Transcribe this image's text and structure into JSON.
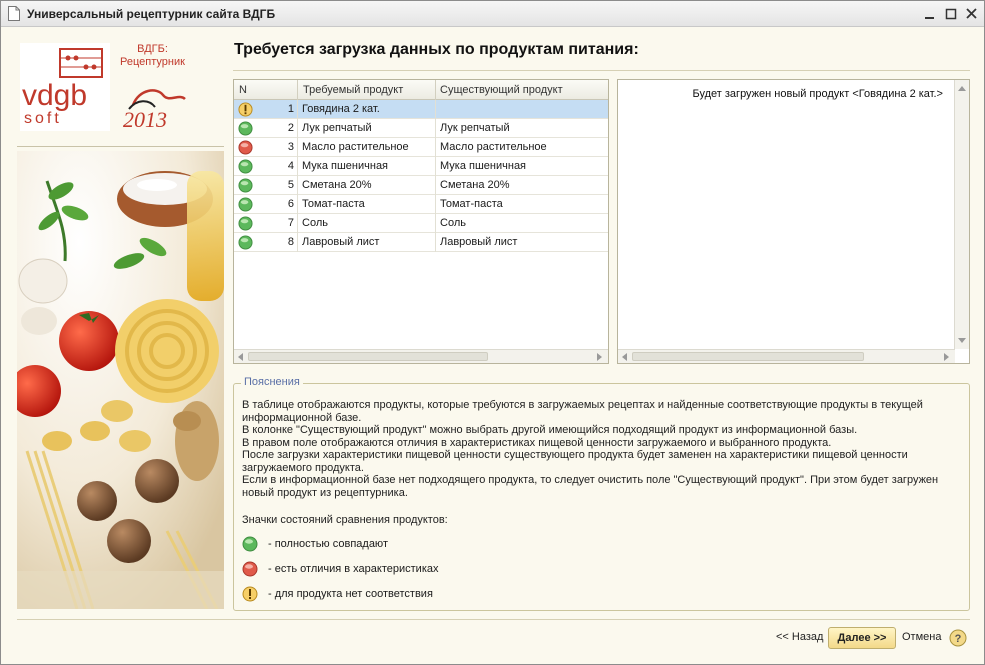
{
  "window": {
    "title": "Универсальный рецептурник сайта ВДГБ"
  },
  "brand": {
    "logo_text_top": "vdgb",
    "logo_text_bottom": "soft",
    "name_line1": "ВДГБ:",
    "name_line2": "Рецептурник",
    "year_logo": "2013"
  },
  "main": {
    "heading": "Требуется загрузка данных по продуктам питания:"
  },
  "table": {
    "columns": [
      "N",
      "Требуемый продукт",
      "Существующий продукт"
    ],
    "rows": [
      {
        "status": "none",
        "n": "1",
        "required": "Говядина  2 кат.",
        "existing": ""
      },
      {
        "status": "match",
        "n": "2",
        "required": "Лук репчатый",
        "existing": "Лук репчатый"
      },
      {
        "status": "diff",
        "n": "3",
        "required": "Масло растительное",
        "existing": "Масло растительное"
      },
      {
        "status": "match",
        "n": "4",
        "required": "Мука пшеничная",
        "existing": "Мука пшеничная"
      },
      {
        "status": "match",
        "n": "5",
        "required": "Сметана 20%",
        "existing": "Сметана 20%"
      },
      {
        "status": "match",
        "n": "6",
        "required": "Томат-паста",
        "existing": "Томат-паста"
      },
      {
        "status": "match",
        "n": "7",
        "required": "Соль",
        "existing": "Соль"
      },
      {
        "status": "match",
        "n": "8",
        "required": "Лавровый лист",
        "existing": "Лавровый лист"
      }
    ],
    "selected_row": 0
  },
  "info_panel": {
    "text": "Будет загружен новый продукт <Говядина  2 кат.>"
  },
  "explanation": {
    "legend": "Пояснения",
    "lines": [
      "В таблице отображаются продукты, которые требуются в загружаемых рецептах и найденные соответствующие продукты в текущей",
      "информационной базе.",
      "В колонке \"Существующий продукт\" можно выбрать другой имеющийся подходящий продукт из информационной базы.",
      "В правом поле отображаются отличия в характеристиках пищевой ценности загружаемого и выбранного продукта.",
      "После загрузки характеристики пищевой ценности существующего продукта будет заменен на характеристики пищевой ценности",
      "загружаемого продукта.",
      "Если в информационной базе нет подходящего продукта, то следует очистить поле \"Существующий продукт\". При этом будет загружен",
      "новый продукт из рецептурника."
    ],
    "legend_title": "Значки состояний сравнения продуктов:",
    "legend_items": [
      {
        "status": "match",
        "text": "- полностью совпадают"
      },
      {
        "status": "diff",
        "text": "- есть отличия в характеристиках"
      },
      {
        "status": "none",
        "text": "- для продукта нет соответствия"
      }
    ]
  },
  "footer": {
    "back": "<< Назад",
    "next": "Далее >>",
    "cancel": "Отмена"
  },
  "colors": {
    "match": "#5cb85c",
    "diff": "#e05a4a",
    "none": "#f0b030",
    "selected_row": "#c5ddf3",
    "legend_label": "#5a6fa6",
    "brand_red": "#c0392b"
  }
}
